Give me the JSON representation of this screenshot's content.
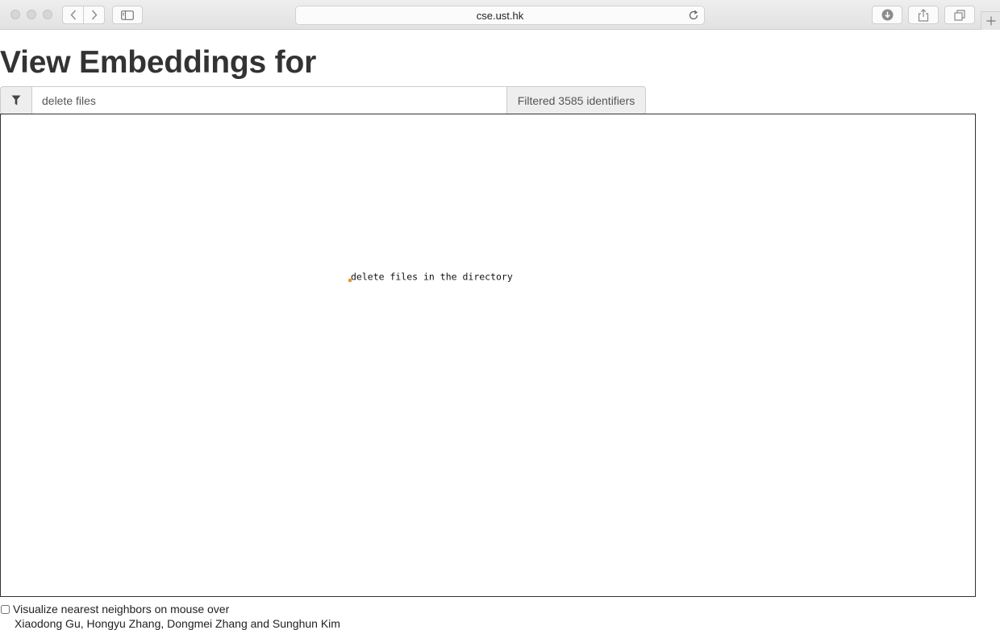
{
  "browser": {
    "url": "cse.ust.hk",
    "icons": [
      "back-icon",
      "forward-icon",
      "sidebar-icon",
      "reload-icon",
      "download-icon",
      "share-icon",
      "tabs-icon",
      "plus-icon"
    ]
  },
  "page": {
    "title": "View Embeddings for",
    "filter": {
      "icon": "filter-icon",
      "value": "delete files",
      "count_label": "Filtered 3585 identifiers"
    },
    "embedding": {
      "points": [
        {
          "label": "delete files in the directory",
          "color": "#e8962a"
        }
      ]
    },
    "options": {
      "nearest_neighbors_label": "Visualize nearest neighbors on mouse over",
      "nearest_neighbors_checked": false
    },
    "credits": "Xiaodong Gu, Hongyu Zhang, Dongmei Zhang and Sunghun Kim"
  }
}
